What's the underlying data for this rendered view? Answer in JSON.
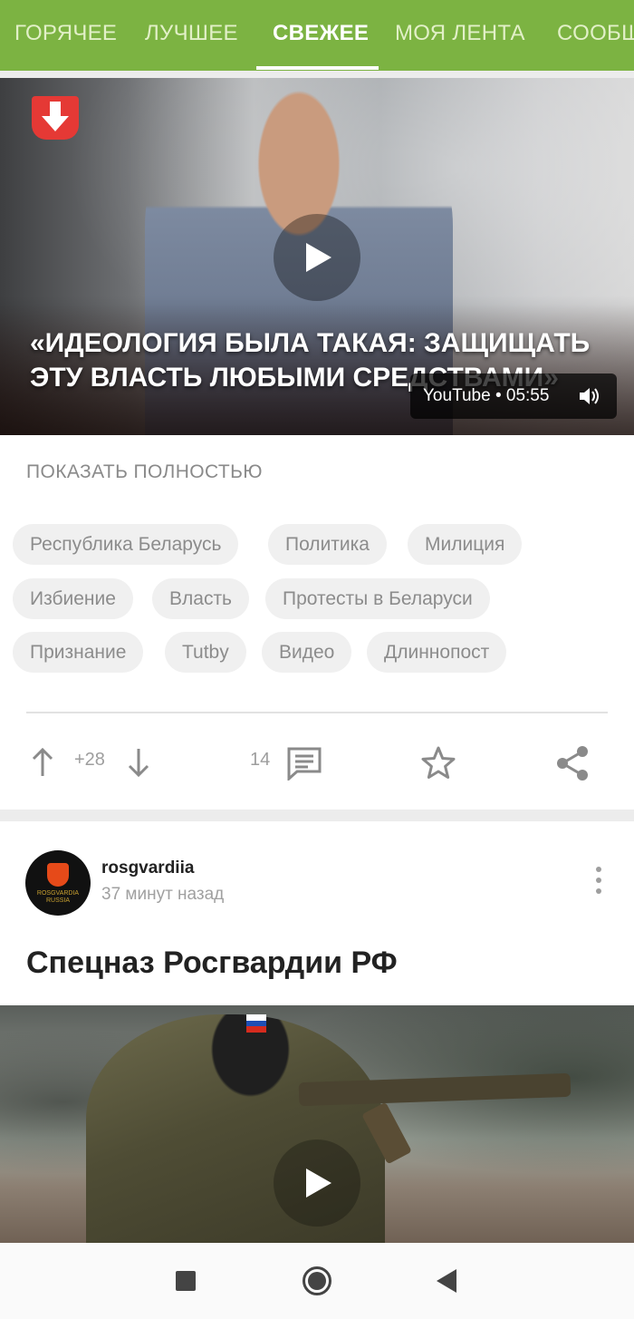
{
  "tabs": [
    {
      "label": "ГОРЯЧЕЕ",
      "active": false
    },
    {
      "label": "ЛУЧШЕЕ",
      "active": false
    },
    {
      "label": "СВЕЖЕЕ",
      "active": true
    },
    {
      "label": "МОЯ ЛЕНТА",
      "active": false
    },
    {
      "label": "СООБЩ",
      "active": false
    }
  ],
  "post1": {
    "video": {
      "title_line1": "«ИДЕОЛОГИЯ БЫЛА ТАКАЯ: ЗАЩИЩАТЬ",
      "title_line2": "ЭТУ ВЛАСТЬ ЛЮБЫМИ СРЕДСТВАМИ»",
      "source_label": "YouTube • 05:55",
      "logo_icon": "down-arrow-logo-icon",
      "play_icon": "play-icon"
    },
    "show_full_label": "ПОКАЗАТЬ ПОЛНОСТЬЮ",
    "tags": [
      "Республика Беларусь",
      "Политика",
      "Милиция",
      "Избиение",
      "Власть",
      "Протесты в Беларуси",
      "Признание",
      "Tutby",
      "Видео",
      "Длиннопост"
    ],
    "rating": "+28",
    "comments_count": "14"
  },
  "post2": {
    "author": "rosgvardiia",
    "time": "37 минут назад",
    "avatar_text": "ROSGVARDIA RUSSIA",
    "title": "Спецназ Росгвардии РФ"
  },
  "colors": {
    "accent": "#7cb342",
    "tag_bg": "#f0f0f0",
    "logo_red": "#e53935"
  }
}
